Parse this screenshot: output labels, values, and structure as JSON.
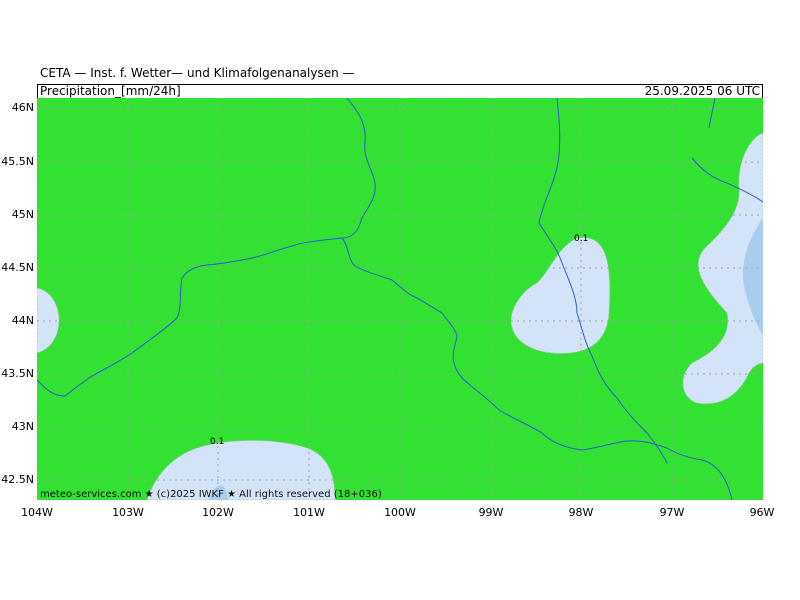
{
  "header": {
    "title": "CETA — Inst. f. Wetter— und Klimafolgenanalysen —",
    "parameter": "Precipitation_[mm/24h]",
    "valid_time": "25.09.2025 06 UTC"
  },
  "footer": {
    "credit": "meteo-services.com ★ (c)2025 IWKF ★ All rights reserved (18+036)"
  },
  "map": {
    "lon_labels": [
      "104W",
      "103W",
      "102W",
      "101W",
      "100W",
      "99W",
      "98W",
      "97W",
      "96W"
    ],
    "lat_labels": [
      "46N",
      "45.5N",
      "45N",
      "44.5N",
      "44N",
      "43.5N",
      "43N",
      "42.5N"
    ],
    "contour_labels": [
      "0.1",
      "0.1"
    ],
    "colors": {
      "background": "#33e133",
      "precip_low": "#d4e4f8",
      "precip_mid": "#a9cdee",
      "rivers": "#2f5bd0",
      "grid": "#a0a0a0"
    }
  }
}
